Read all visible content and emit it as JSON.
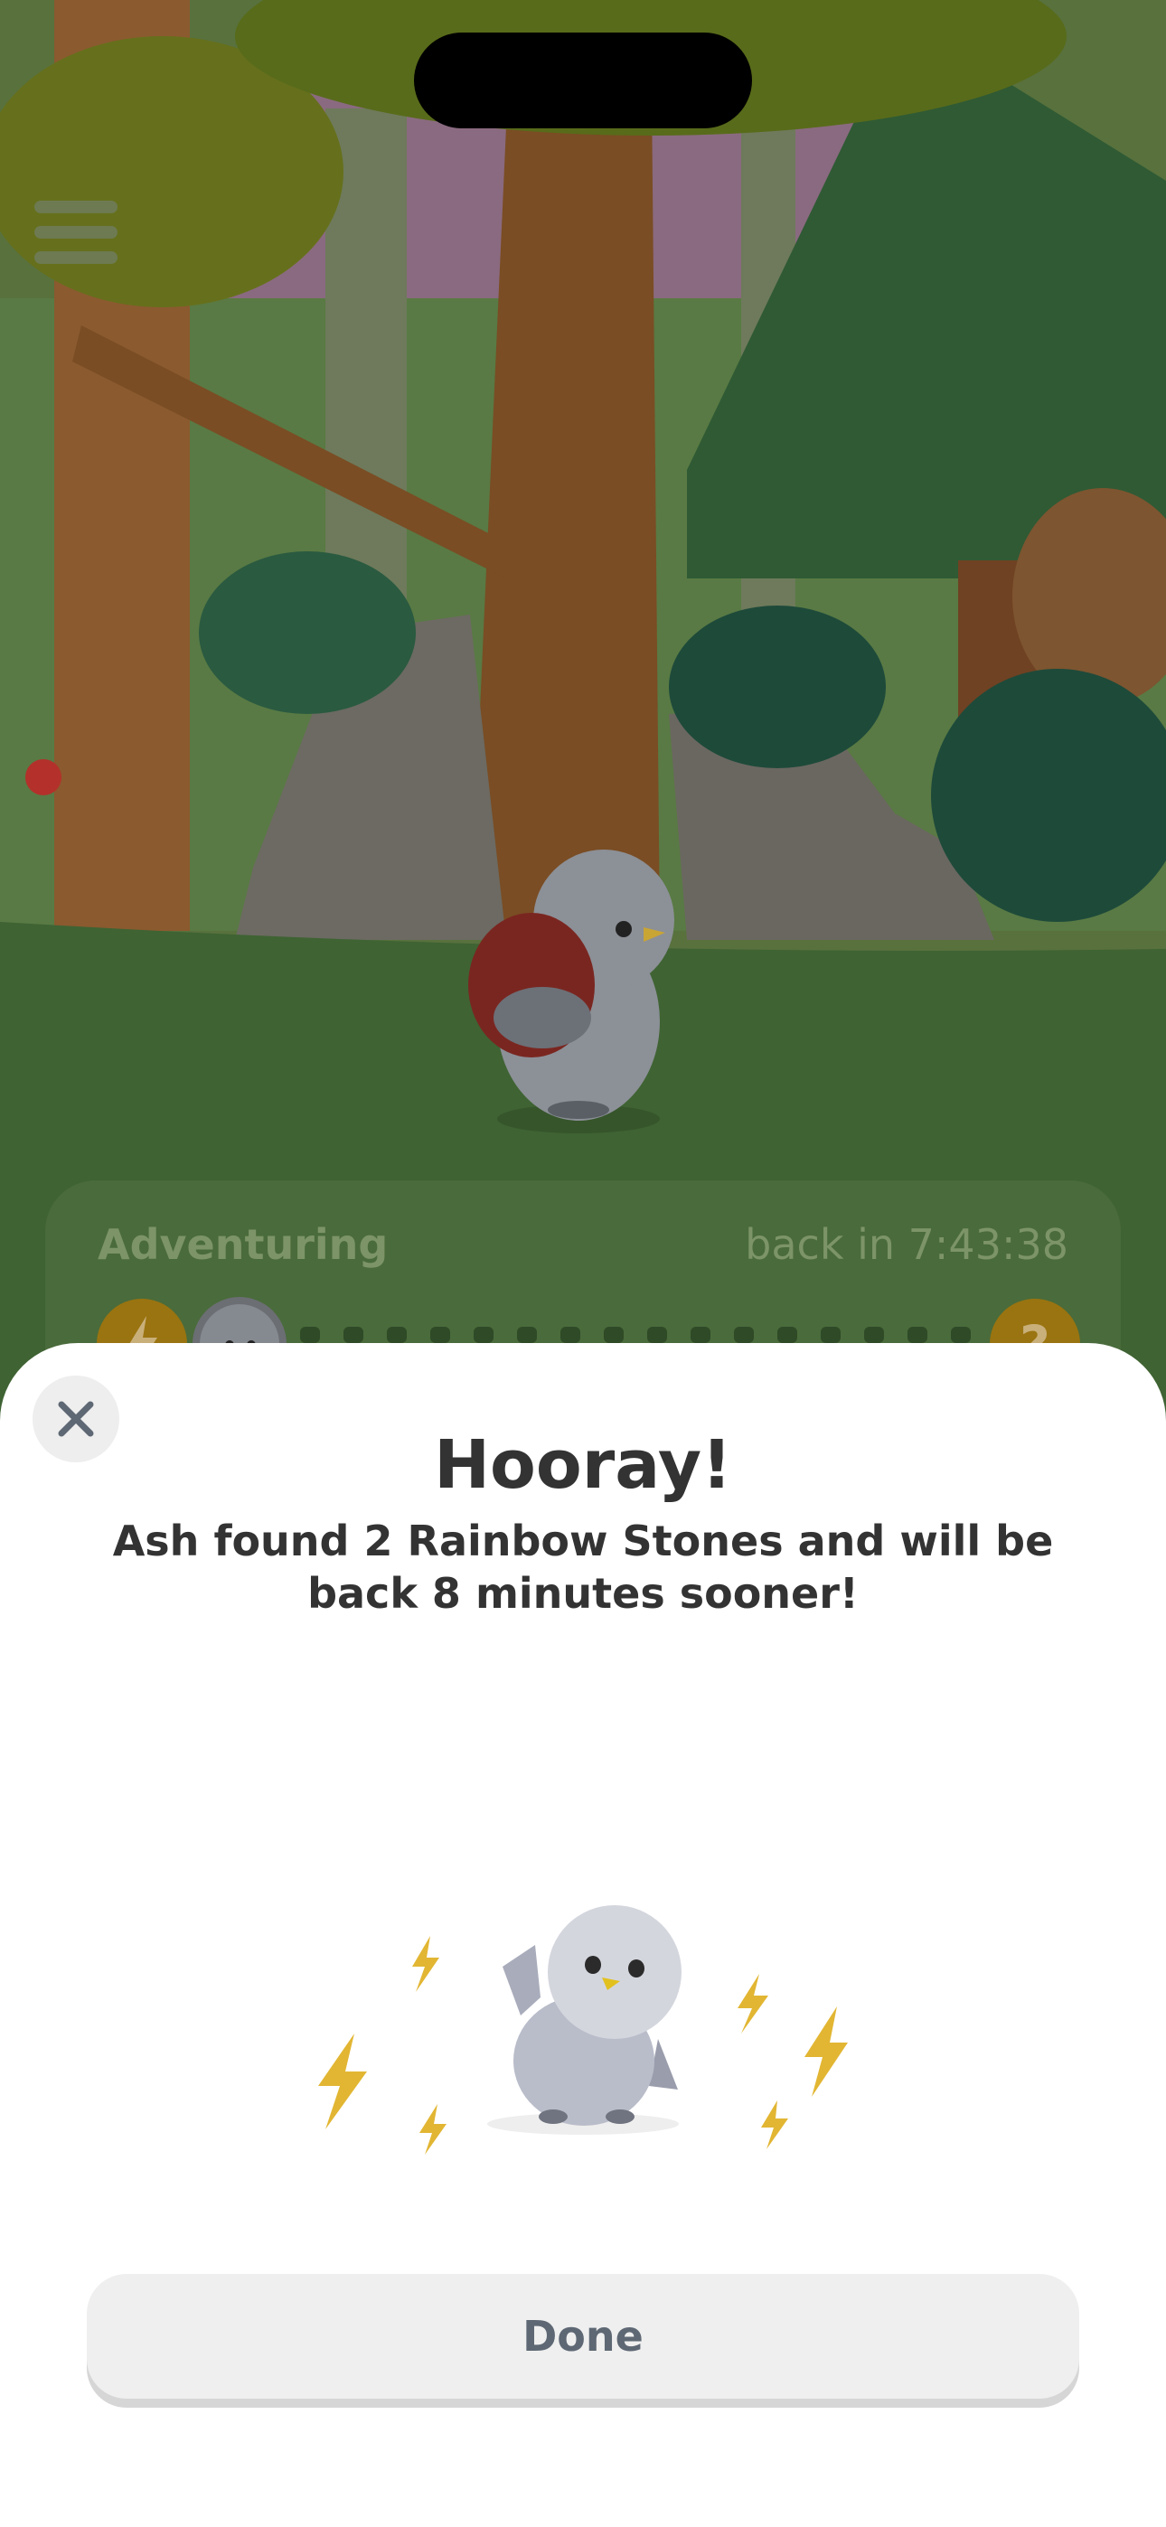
{
  "header": {
    "menu_icon": "hamburger-menu-icon"
  },
  "adventure": {
    "status_label": "Adventuring",
    "return_text": "back in 7:43:38",
    "left_icon": "lightning-icon",
    "right_icon": "question-icon"
  },
  "modal": {
    "close_icon": "close-icon",
    "title": "Hooray!",
    "message": "Ash found 2 Rainbow Stones and will be back 8 minutes sooner!",
    "illustration_icon": "bird-with-lightning-icon",
    "done_label": "Done"
  },
  "colors": {
    "sheet_bg": "#ffffff",
    "button_bg": "#efefef",
    "title_text": "#333333",
    "lightning": "#e2b633"
  }
}
